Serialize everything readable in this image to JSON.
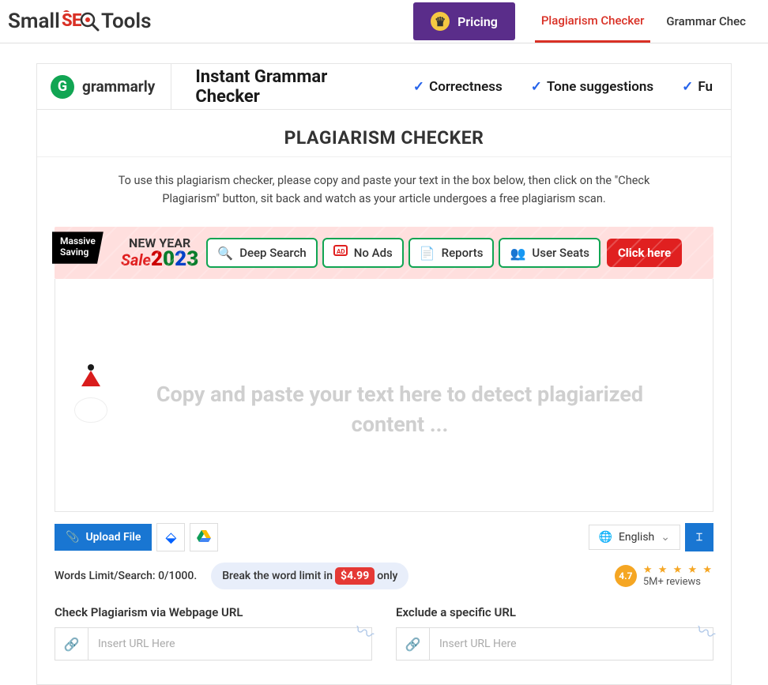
{
  "logo": {
    "part1": "Small",
    "seo": "SE",
    "part2": "Tools"
  },
  "nav": {
    "pricing": "Pricing",
    "plagiarism": "Plagiarism Checker",
    "grammar": "Grammar Chec"
  },
  "grammarly": {
    "brand": "grammarly",
    "title": "Instant Grammar Checker",
    "feat1": "Correctness",
    "feat2": "Tone suggestions",
    "feat3": "Fu"
  },
  "page": {
    "title": "PLAGIARISM CHECKER",
    "instructions": "To use this plagiarism checker, please copy and paste your text in the box below, then click on the \"Check Plagiarism\" button, sit back and watch as your article undergoes a free plagiarism scan."
  },
  "promo": {
    "massive1": "Massive",
    "massive2": "Saving",
    "newyear": "NEW YEAR",
    "sale": "Sale",
    "y1": "2",
    "y2": "0",
    "y3": "2",
    "y4": "3",
    "deep": "Deep Search",
    "noads": "No Ads",
    "reports": "Reports",
    "seats": "User Seats",
    "cta": "Click here"
  },
  "editor": {
    "placeholder": "Copy and paste your text here to detect plagiarized content ..."
  },
  "toolbar": {
    "upload": "Upload File",
    "language": "English"
  },
  "limit": {
    "label": "Words Limit/Search: 0/1000.",
    "break_pre": "Break the word limit in",
    "price": "$4.99",
    "break_post": "only"
  },
  "rating": {
    "score": "4.7",
    "stars": "★ ★ ★ ★ ★",
    "reviews": "5M+ reviews"
  },
  "urls": {
    "check_label": "Check Plagiarism via Webpage URL",
    "check_placeholder": "Insert URL Here",
    "exclude_label": "Exclude a specific URL",
    "exclude_placeholder": "Insert URL Here"
  }
}
